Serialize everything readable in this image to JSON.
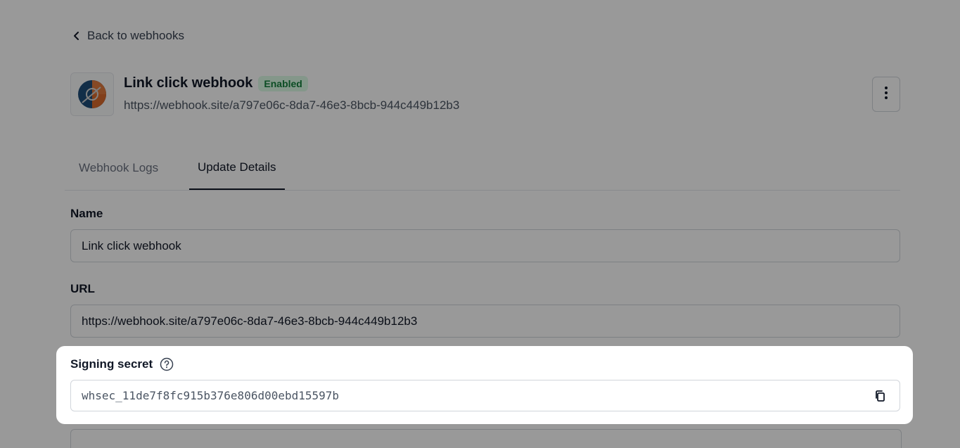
{
  "nav": {
    "back_label": "Back to webhooks"
  },
  "header": {
    "title": "Link click webhook",
    "status_badge": "Enabled",
    "url": "https://webhook.site/a797e06c-8da7-46e3-8bcb-944c449b12b3"
  },
  "tabs": [
    {
      "label": "Webhook Logs",
      "active": false
    },
    {
      "label": "Update Details",
      "active": true
    }
  ],
  "form": {
    "name": {
      "label": "Name",
      "value": "Link click webhook"
    },
    "url": {
      "label": "URL",
      "value": "https://webhook.site/a797e06c-8da7-46e3-8bcb-944c449b12b3"
    },
    "signing_secret": {
      "label": "Signing secret",
      "value": "whsec_11de7f8fc915b376e806d00ebd15597b"
    }
  },
  "colors": {
    "badge_bg": "#dcfce7",
    "badge_text": "#15803d",
    "overlay": "rgba(0,0,0,0.4)"
  },
  "icons": {
    "back": "chevron-left-icon",
    "more": "more-vertical-icon",
    "help": "help-circle-icon",
    "copy": "copy-icon"
  }
}
